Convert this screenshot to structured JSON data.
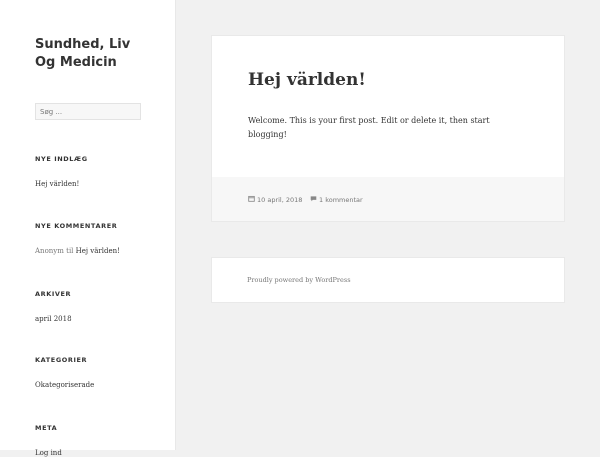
{
  "site": {
    "title": "Sundhed, Liv Og Medicin"
  },
  "search": {
    "placeholder": "Søg ..."
  },
  "widgets": {
    "recent_posts": {
      "title": "NYE INDLÆG",
      "items": [
        "Hej världen!"
      ]
    },
    "recent_comments": {
      "title": "NYE KOMMENTARER",
      "author": "Anonym",
      "connector": "til",
      "post": "Hej världen!"
    },
    "archives": {
      "title": "ARKIVER",
      "items": [
        "april 2018"
      ]
    },
    "categories": {
      "title": "KATEGORIER",
      "items": [
        "Okategoriserade"
      ]
    },
    "meta": {
      "title": "META",
      "items": [
        "Log ind"
      ]
    }
  },
  "post": {
    "title": "Hej världen!",
    "content": "Welcome. This is your first post. Edit or delete it, then start blogging!",
    "date": "10 april, 2018",
    "comments": "1 kommentar",
    "icons": {
      "date": "calendar-icon",
      "comments": "comment-icon"
    }
  },
  "footer": {
    "text": "Proudly powered by WordPress"
  }
}
